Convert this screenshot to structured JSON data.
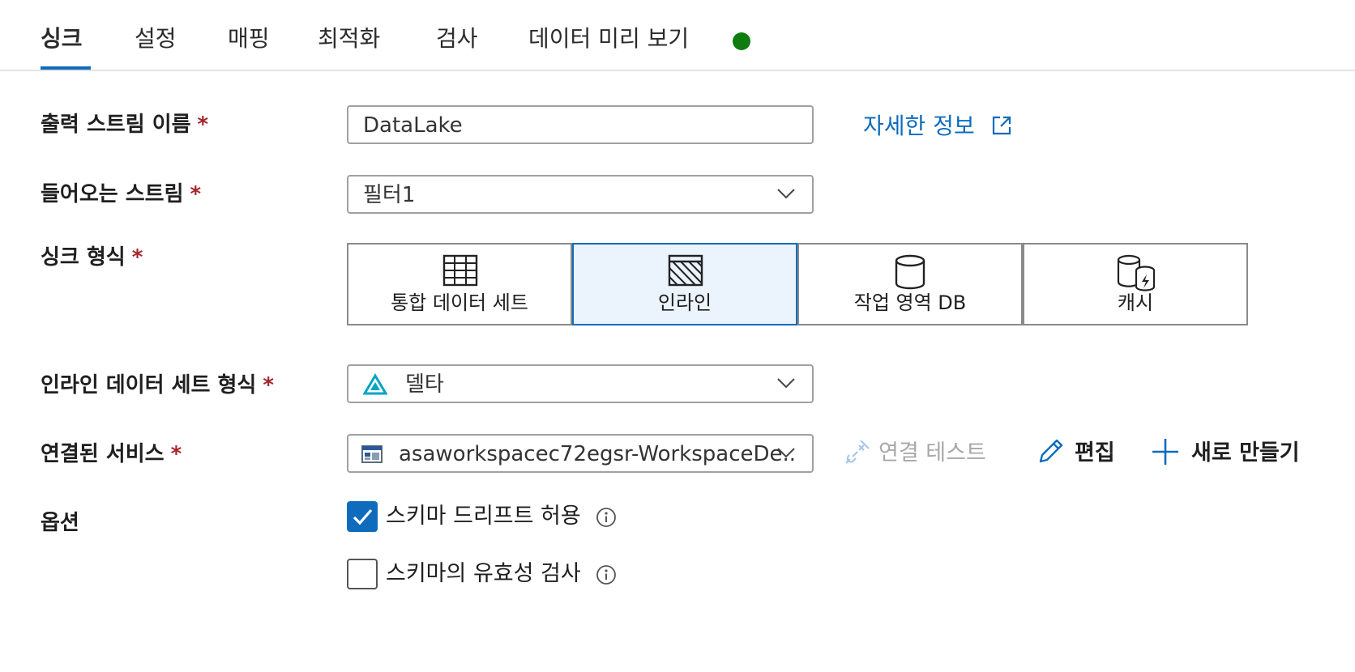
{
  "tabs": [
    {
      "label": "싱크",
      "active": true
    },
    {
      "label": "설정"
    },
    {
      "label": "매핑"
    },
    {
      "label": "최적화"
    },
    {
      "label": "검사"
    },
    {
      "label": "데이터 미리 보기",
      "status_color": "#107c10"
    }
  ],
  "required_mark": "*",
  "output_stream": {
    "label": "출력 스트림 이름",
    "value": "DataLake",
    "learn_more": "자세한 정보"
  },
  "incoming_stream": {
    "label": "들어오는 스트림",
    "value": "필터1"
  },
  "sink_type": {
    "label": "싱크 형식",
    "options": [
      {
        "label": "통합 데이터 세트",
        "icon": "table-grid-icon"
      },
      {
        "label": "인라인",
        "icon": "inline-hatched-icon",
        "selected": true
      },
      {
        "label": "작업 영역 DB",
        "icon": "database-icon"
      },
      {
        "label": "캐시",
        "icon": "cache-icon"
      }
    ]
  },
  "inline_dataset_type": {
    "label": "인라인 데이터 세트 형식",
    "value": "델타",
    "icon": "delta-icon"
  },
  "linked_service": {
    "label": "연결된 서비스",
    "value": "asaworkspacec72egsr-WorkspaceDe..",
    "icon": "workspace-icon",
    "actions": {
      "test_connection": "연결 테스트",
      "edit": "편집",
      "new": "새로 만들기"
    }
  },
  "options": {
    "label": "옵션",
    "allow_schema_drift": {
      "label": "스키마 드리프트 허용",
      "checked": true
    },
    "validate_schema": {
      "label": "스키마의 유효성 검사",
      "checked": false
    }
  },
  "colors": {
    "accent": "#0f6cbd",
    "required": "#a4262c",
    "status_ok": "#107c10",
    "disabled": "#a8a8a8"
  }
}
